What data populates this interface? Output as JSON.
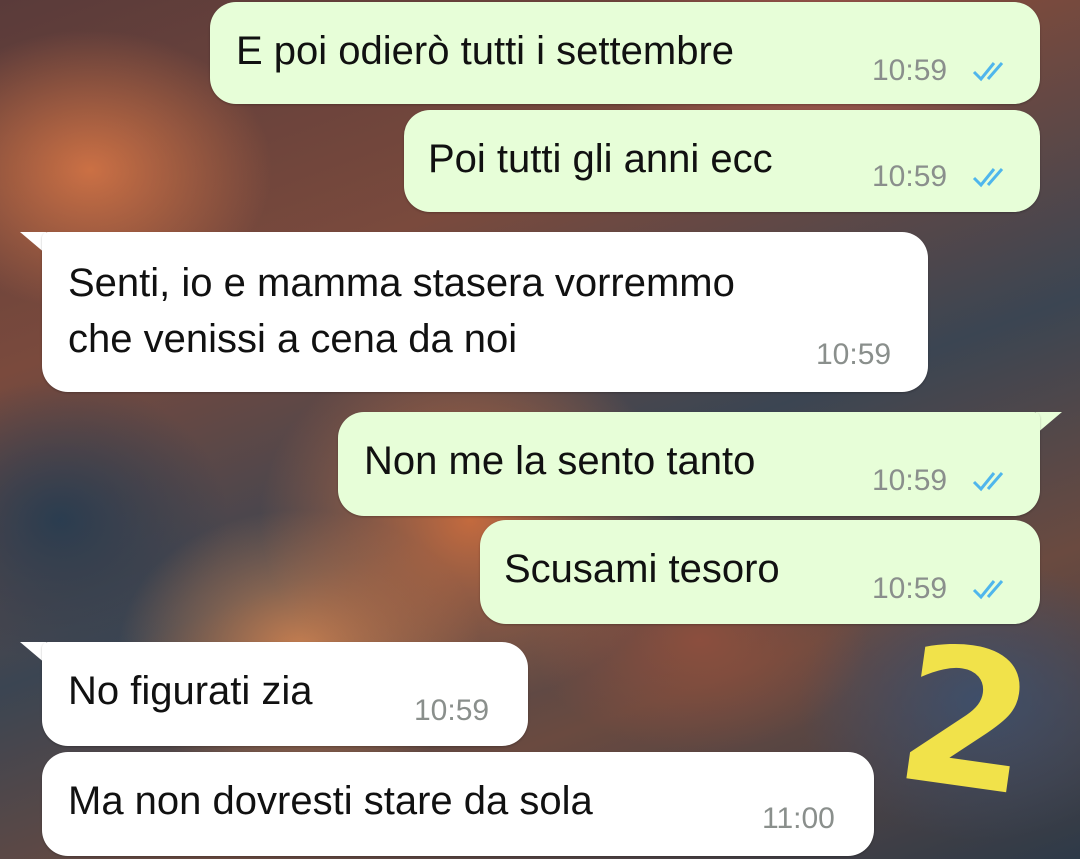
{
  "chat": {
    "messages": [
      {
        "direction": "out",
        "text": "E poi odierò tutti i settembre",
        "time": "10:59",
        "status": "read"
      },
      {
        "direction": "out",
        "text": "Poi tutti gli anni ecc",
        "time": "10:59",
        "status": "read"
      },
      {
        "direction": "in",
        "lines": [
          "Senti, io e mamma stasera vorremmo",
          "che venissi a cena da noi"
        ],
        "time": "10:59"
      },
      {
        "direction": "out",
        "text": "Non me la sento tanto",
        "time": "10:59",
        "status": "read"
      },
      {
        "direction": "out",
        "text": "Scusami tesoro",
        "time": "10:59",
        "status": "read"
      },
      {
        "direction": "in",
        "text": "No figurati zia",
        "time": "10:59"
      },
      {
        "direction": "in",
        "text": "Ma non dovresti stare da sola",
        "time": "11:00"
      }
    ]
  },
  "annotation": {
    "text": "2",
    "color": "#f1e24a"
  },
  "colors": {
    "outgoing_bubble": "#e7fed8",
    "incoming_bubble": "#ffffff",
    "read_ticks": "#4fb6ec",
    "timestamp": "#8a8f8c"
  },
  "icons": {
    "read_receipt": "double-check-icon"
  }
}
